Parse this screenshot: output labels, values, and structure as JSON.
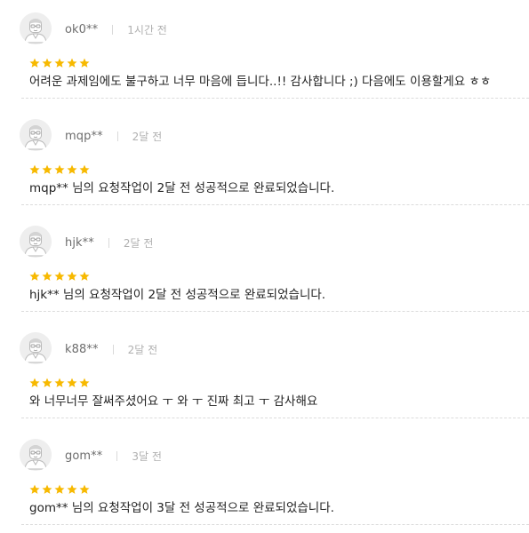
{
  "colors": {
    "star": "#f7b900",
    "username": "#6d6d6d",
    "time": "#b0b0b0",
    "comment": "#222222",
    "divider": "#dcdcdc"
  },
  "reviews": [
    {
      "username": "ok0**",
      "time": "1시간 전",
      "rating": 5,
      "comment": "어려운 과제임에도 불구하고 너무 마음에 듭니다..!! 감사합니다 ;) 다음에도 이용할게요 ㅎㅎ",
      "avatar_icon": "user-avatar-icon"
    },
    {
      "username": "mqp**",
      "time": "2달 전",
      "rating": 5,
      "comment": "mqp** 님의 요청작업이 2달 전 성공적으로 완료되었습니다.",
      "avatar_icon": "user-avatar-icon"
    },
    {
      "username": "hjk**",
      "time": "2달 전",
      "rating": 5,
      "comment": "hjk** 님의 요청작업이 2달 전 성공적으로 완료되었습니다.",
      "avatar_icon": "user-avatar-icon"
    },
    {
      "username": "k88**",
      "time": "2달 전",
      "rating": 5,
      "comment": "와 너무너무 잘써주셨어요 ㅜ 와 ㅜ 진짜 최고 ㅜ 감사해요",
      "avatar_icon": "user-avatar-icon"
    },
    {
      "username": "gom**",
      "time": "3달 전",
      "rating": 5,
      "comment": "gom** 님의 요청작업이 3달 전 성공적으로 완료되었습니다.",
      "avatar_icon": "user-avatar-icon"
    }
  ]
}
